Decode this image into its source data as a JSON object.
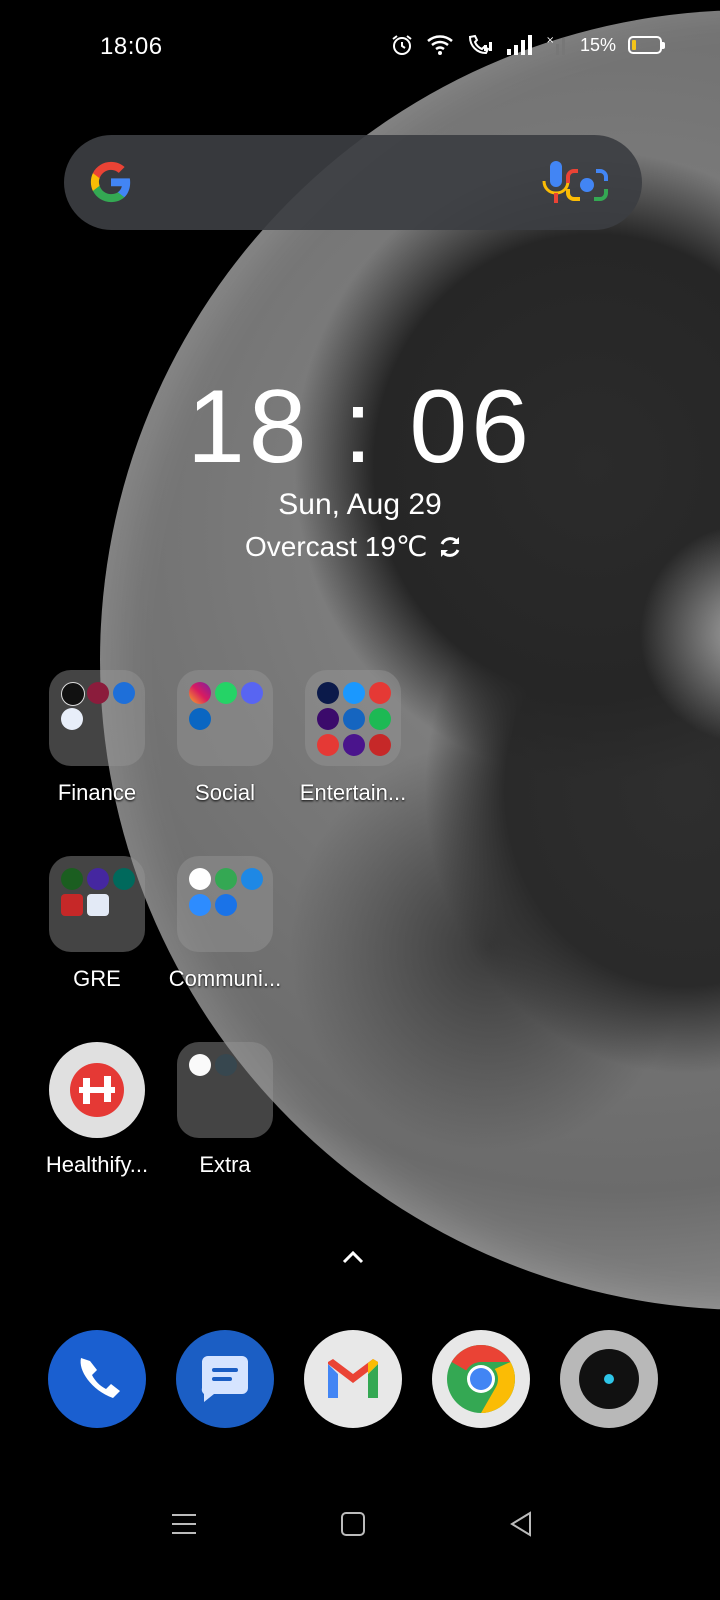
{
  "status_bar": {
    "time": "18:06",
    "battery_percent": "15%",
    "icons": [
      "alarm-icon",
      "wifi-icon",
      "wifi-calling-icon",
      "signal-icon",
      "signal-no-sim-icon",
      "battery-icon"
    ]
  },
  "search": {
    "icons": [
      "google-g-icon",
      "mic-icon",
      "lens-icon"
    ]
  },
  "clock_widget": {
    "time": "18 : 06",
    "date": "Sun, Aug 29",
    "weather": "Overcast 19℃"
  },
  "apps": [
    {
      "label": "Finance",
      "type": "folder"
    },
    {
      "label": "Social",
      "type": "folder"
    },
    {
      "label": "Entertain...",
      "type": "folder"
    },
    {
      "label": "GRE",
      "type": "folder"
    },
    {
      "label": "Communi...",
      "type": "folder"
    },
    {
      "label": "Healthify...",
      "type": "app"
    },
    {
      "label": "Extra",
      "type": "folder"
    }
  ],
  "dock": [
    "phone-icon",
    "messages-icon",
    "gmail-icon",
    "chrome-icon",
    "camera-icon"
  ],
  "nav": [
    "menu-icon",
    "home-icon",
    "back-icon"
  ],
  "colors": {
    "search_bg": "#3c3e42",
    "phone_blue": "#1a5fd0",
    "messages_blue": "#1b5ec4",
    "battery_low": "#f5c518"
  }
}
